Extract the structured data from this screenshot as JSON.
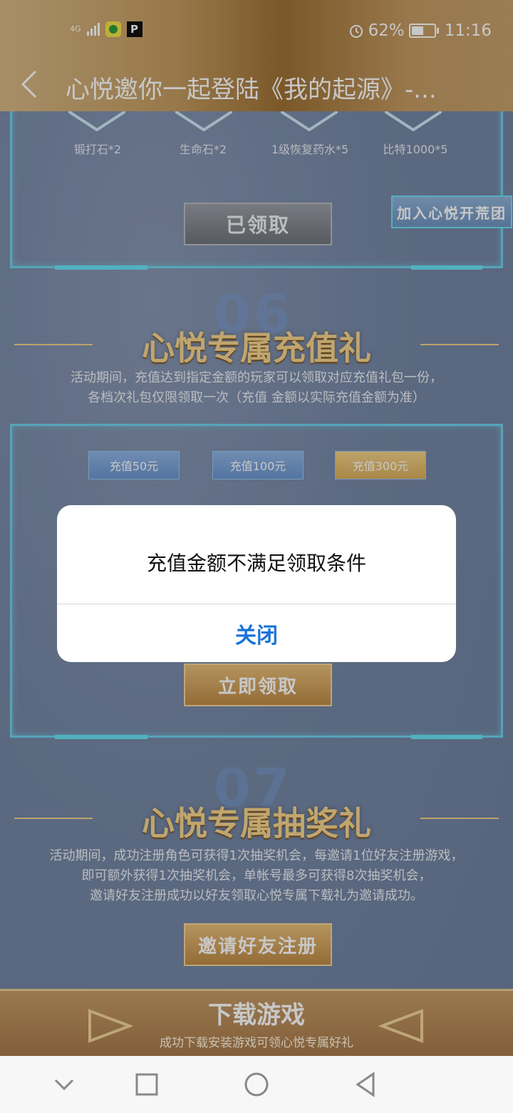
{
  "status_bar": {
    "network": "4G",
    "battery": "62%",
    "battery_level": 0.62,
    "time": "11:16",
    "app_badge_2": "P"
  },
  "header": {
    "title": "心悦邀你一起登陆《我的起源》-..."
  },
  "section_top": {
    "rewards": [
      "锻打石*2",
      "生命石*2",
      "1级恢复药水*5",
      "比特1000*5"
    ],
    "claimed_label": "已领取",
    "join_label": "加入心悦开荒团"
  },
  "section_06": {
    "number": "06",
    "title": "心悦专属充值礼",
    "desc_line1": "活动期间，充值达到指定金额的玩家可以领取对应充值礼包一份，",
    "desc_line2": "各档次礼包仅限领取一次（充值 金额以实际充值金额为准）",
    "tabs": [
      "充值50元",
      "充值100元",
      "充值300元"
    ],
    "claim_label": "立即领取"
  },
  "section_07": {
    "number": "07",
    "title": "心悦专属抽奖礼",
    "desc_line1": "活动期间，成功注册角色可获得1次抽奖机会，每邀请1位好友注册游戏，",
    "desc_line2": "即可额外获得1次抽奖机会，单帐号最多可获得8次抽奖机会，",
    "desc_line3": "邀请好友注册成功以好友领取心悦专属下载礼为邀请成功。",
    "invite_label": "邀请好友注册"
  },
  "download": {
    "title": "下载游戏",
    "subtitle": "成功下载安装游戏可领心悦专属好礼"
  },
  "dialog": {
    "message": "充值金额不满足领取条件",
    "close_label": "关闭"
  },
  "colors": {
    "dialog_button": "#1a73d9",
    "panel_border": "#6fd3ec",
    "title_gold": "#f6d48d"
  }
}
